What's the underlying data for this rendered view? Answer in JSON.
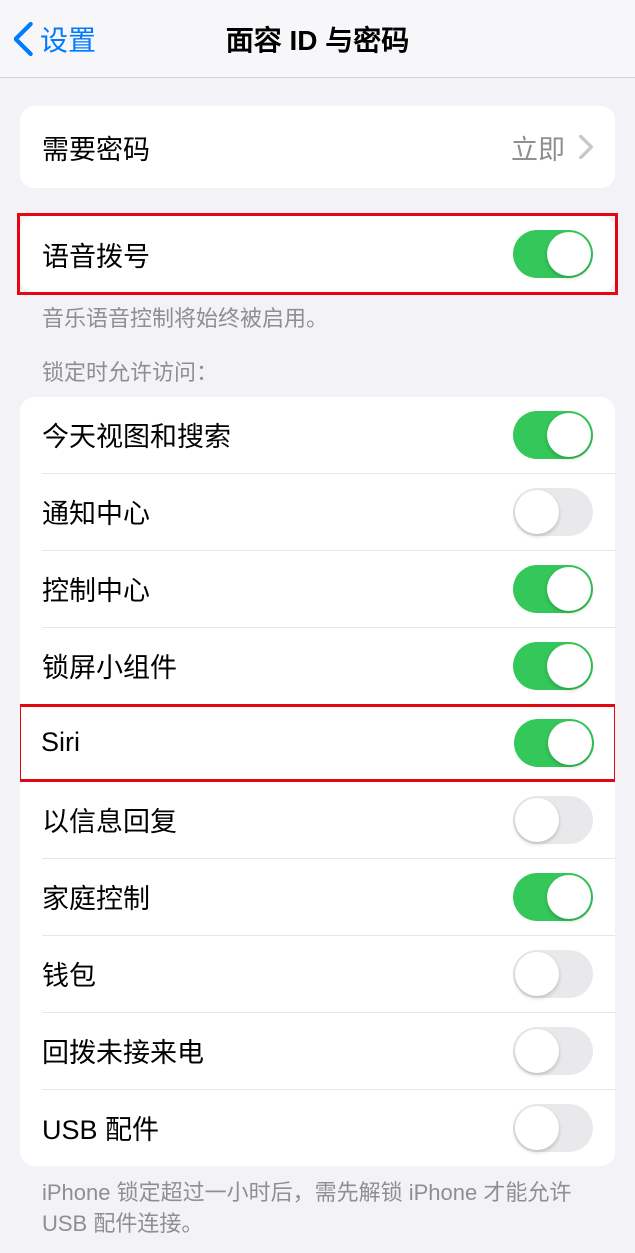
{
  "navbar": {
    "back_label": "设置",
    "title": "面容 ID 与密码"
  },
  "require_passcode": {
    "label": "需要密码",
    "value": "立即"
  },
  "voice_dial": {
    "label": "语音拨号",
    "on": true,
    "footer": "音乐语音控制将始终被启用。"
  },
  "lock_access": {
    "header": "锁定时允许访问：",
    "items": [
      {
        "label": "今天视图和搜索",
        "on": true,
        "highlighted": false
      },
      {
        "label": "通知中心",
        "on": false,
        "highlighted": false
      },
      {
        "label": "控制中心",
        "on": true,
        "highlighted": false
      },
      {
        "label": "锁屏小组件",
        "on": true,
        "highlighted": false
      },
      {
        "label": "Siri",
        "on": true,
        "highlighted": true
      },
      {
        "label": "以信息回复",
        "on": false,
        "highlighted": false
      },
      {
        "label": "家庭控制",
        "on": true,
        "highlighted": false
      },
      {
        "label": "钱包",
        "on": false,
        "highlighted": false
      },
      {
        "label": "回拨未接来电",
        "on": false,
        "highlighted": false
      },
      {
        "label": "USB 配件",
        "on": false,
        "highlighted": false
      }
    ],
    "footer": "iPhone 锁定超过一小时后，需先解锁 iPhone 才能允许 USB 配件连接。"
  }
}
